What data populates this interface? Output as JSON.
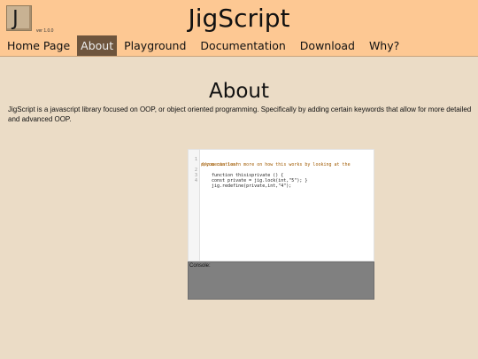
{
  "header": {
    "logo_letter": "J",
    "version": "ver 1.0.0",
    "title": "JigScript"
  },
  "nav": {
    "items": [
      {
        "label": "Home Page",
        "active": false
      },
      {
        "label": "About",
        "active": true
      },
      {
        "label": "Playground",
        "active": false
      },
      {
        "label": "Documentation",
        "active": false
      },
      {
        "label": "Download",
        "active": false
      },
      {
        "label": "Why?",
        "active": false
      }
    ]
  },
  "main": {
    "heading": "About",
    "intro": "JigScript is a javascript library focused on OOP, or object oriented programming. Specifically by adding certain keywords that allow for more detailed and advanced OOP."
  },
  "editor": {
    "line_numbers": [
      "1",
      "2",
      "3",
      "4"
    ],
    "comment_line1": "//you can learn more on how this works by looking at the",
    "comment_line2": "documentation!",
    "line2": "function thisisprivate () {",
    "line3": "const private = jig.lock(int,\"5\"); }",
    "line4": "jig.redefine(private,int,\"4\");"
  },
  "console": {
    "label": "Console:"
  },
  "colors": {
    "page_bg": "#ebdcc6",
    "header_bg": "#fdc893",
    "active_nav_bg": "#6e553d",
    "console_bg": "#808080"
  }
}
